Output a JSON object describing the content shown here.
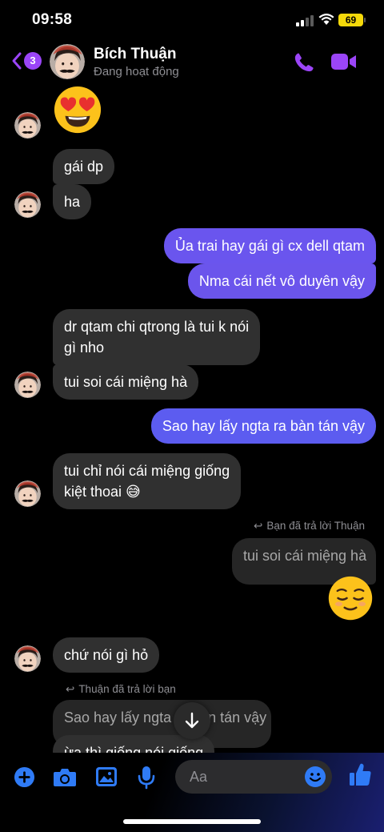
{
  "status_bar": {
    "time": "09:58",
    "battery": "69"
  },
  "header": {
    "back_badge": "3",
    "contact_name": "Bích Thuận",
    "contact_status": "Đang hoạt động",
    "icons": [
      "chevron-left-icon",
      "phone-icon",
      "video-camera-icon"
    ]
  },
  "colors": {
    "accent": "#9b45f7",
    "outgoing_bubble": "#6b55ec",
    "incoming_bubble": "#303030",
    "composer_icon": "#2f7bf6"
  },
  "messages": {
    "m1_emoji": "😍",
    "m2": "gái dp",
    "m3": "ha",
    "m4": "Ủa trai hay gái gì cx dell qtam",
    "m5": "Nma cái nết vô duyên vậy",
    "m6_line1": "dr qtam chi qtrong là tui k nói",
    "m6_line2": "gì nho",
    "m7": "tui soi cái miệng hà",
    "m8": "Sao hay lấy ngta ra bàn tán vậy",
    "m9_line1": "tui chỉ nói cái miệng giống",
    "m9_line2": "kiệt thoai 😅",
    "reply_meta_out": "Bạn đã trả lời Thuận",
    "quoted_out": "tui soi cái miệng hà",
    "m10_emoji": "😌",
    "m11": "chứ nói gì hỏ",
    "reply_meta_in": "Thuận đã trả lời bạn",
    "quoted_in": "Sao hay lấy ngta ra bàn tán vậy",
    "m12_partial": "ừa thì giống nói giống"
  },
  "composer": {
    "placeholder": "Aa",
    "icons": [
      "plus-icon",
      "camera-icon",
      "image-icon",
      "microphone-icon",
      "emoji-icon",
      "thumbs-up-icon"
    ]
  }
}
